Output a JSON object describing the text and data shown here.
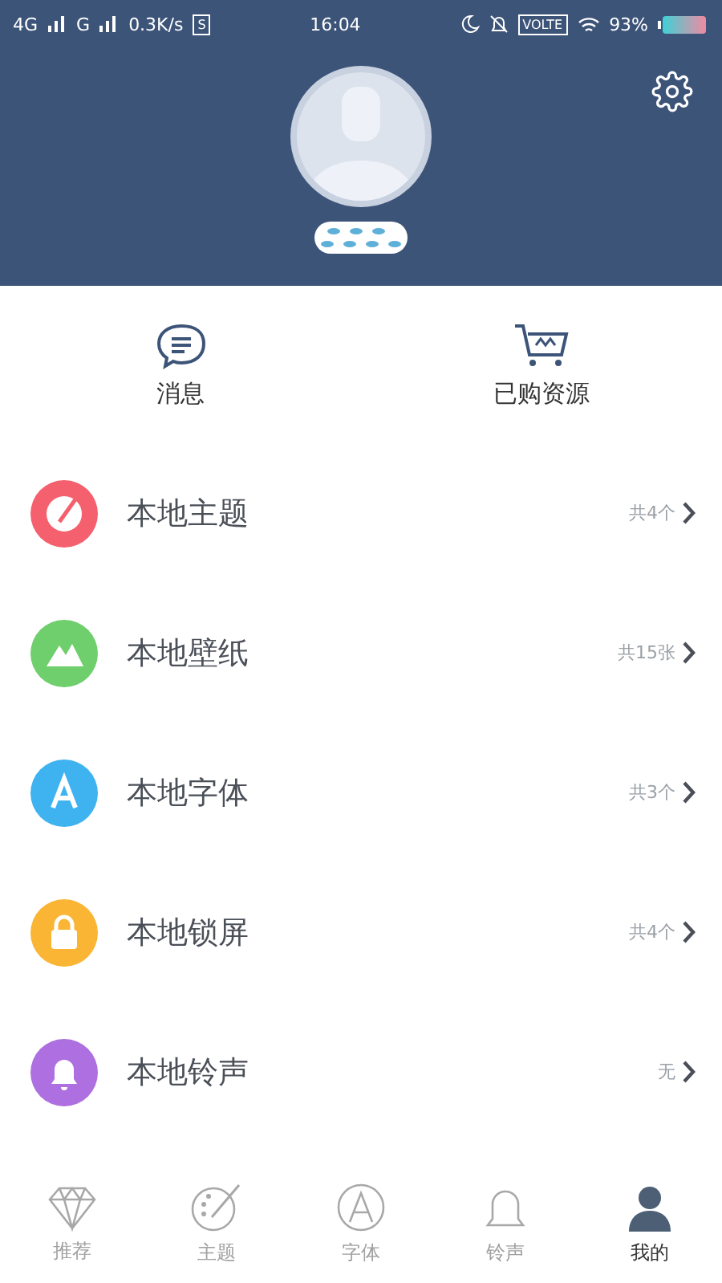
{
  "status_bar": {
    "network_1": "4G",
    "network_2": "G",
    "speed": "0.3K/s",
    "app_badge": "S",
    "time": "16:04",
    "volte": "VOLTE",
    "battery": "93%"
  },
  "quick_actions": [
    {
      "kind": "messages",
      "label": "消息"
    },
    {
      "kind": "cart",
      "label": "已购资源"
    }
  ],
  "menu": [
    {
      "kind": "theme",
      "label": "本地主题",
      "count": "共4个",
      "color": "#f5606e"
    },
    {
      "kind": "wallpaper",
      "label": "本地壁纸",
      "count": "共15张",
      "color": "#6fcf6c"
    },
    {
      "kind": "font",
      "label": "本地字体",
      "count": "共3个",
      "color": "#3fb2f0"
    },
    {
      "kind": "lock",
      "label": "本地锁屏",
      "count": "共4个",
      "color": "#f9b533"
    },
    {
      "kind": "ringtone",
      "label": "本地铃声",
      "count": "无",
      "color": "#ae6fe0"
    }
  ],
  "tabs": [
    {
      "kind": "diamond",
      "label": "推荐",
      "selected": false
    },
    {
      "kind": "palette",
      "label": "主题",
      "selected": false
    },
    {
      "kind": "font",
      "label": "字体",
      "selected": false
    },
    {
      "kind": "bell",
      "label": "铃声",
      "selected": false
    },
    {
      "kind": "person",
      "label": "我的",
      "selected": true
    }
  ]
}
